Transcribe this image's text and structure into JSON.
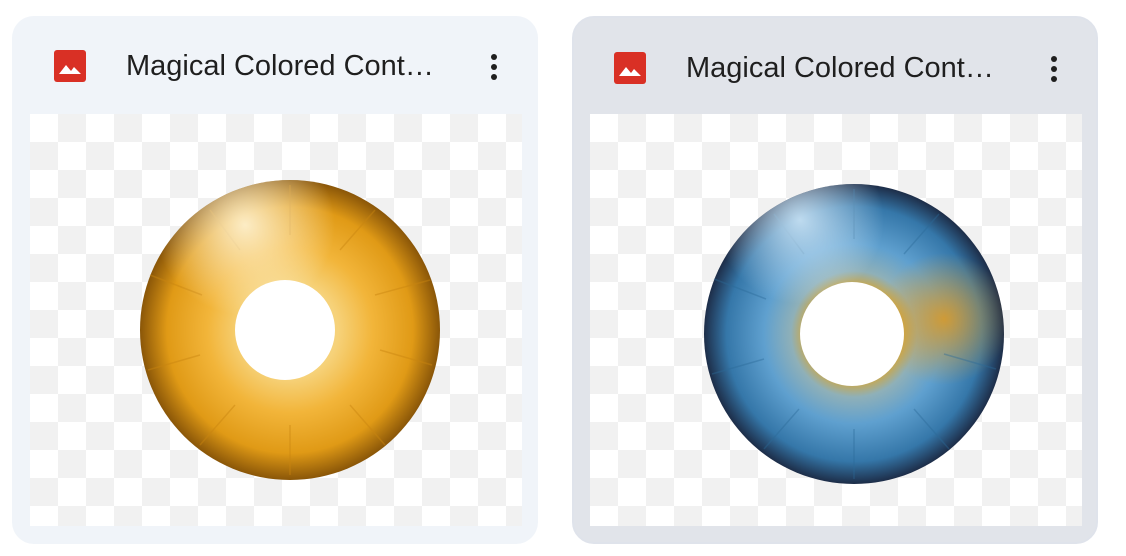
{
  "files": [
    {
      "title": "Magical Colored Cont…",
      "file_type_icon": "image-icon",
      "menu_icon": "more-vert-icon",
      "iris_color": "#e8a21a"
    },
    {
      "title": "Magical Colored Cont…",
      "file_type_icon": "image-icon",
      "menu_icon": "more-vert-icon",
      "iris_color": "#3f86bd"
    }
  ],
  "colors": {
    "card_default_bg": "#f0f4f9",
    "card_hover_bg": "#e1e4ea",
    "image_icon_red": "#d93025"
  }
}
